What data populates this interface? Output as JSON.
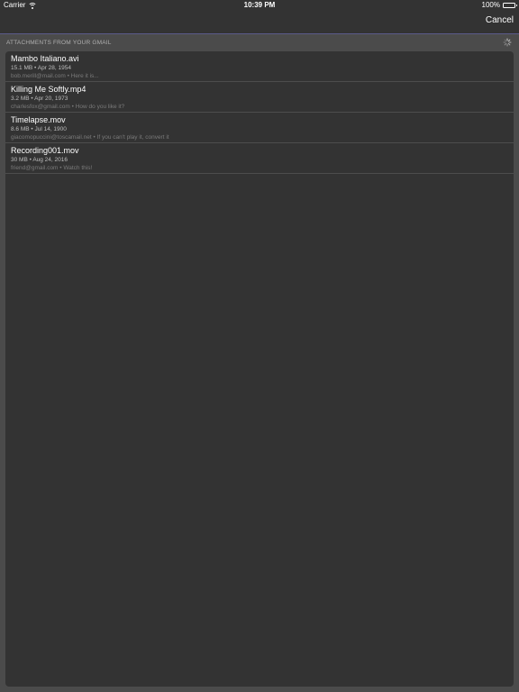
{
  "status_bar": {
    "carrier": "Carrier",
    "time": "10:39 PM",
    "battery": "100%",
    "battery_level": 1.0
  },
  "nav": {
    "cancel_label": "Cancel"
  },
  "section": {
    "header": "ATTACHMENTS FROM YOUR GMAIL"
  },
  "attachments": [
    {
      "name": "Mambo Italiano.avi",
      "meta": "15.1 MB • Apr 28, 1954",
      "sub": "bob.merill@mail.com • Here it is..."
    },
    {
      "name": "Killing Me Softly.mp4",
      "meta": "3.2 MB • Apr 20, 1973",
      "sub": "charlesfox@gmail.com • How do you like it?"
    },
    {
      "name": "Timelapse.mov",
      "meta": "8.6 MB • Jul 14, 1900",
      "sub": "giacomopuccini@toscamail.net • If you can't play it, convert it"
    },
    {
      "name": "Recording001.mov",
      "meta": "30 MB • Aug 24, 2016",
      "sub": "friend@gmail.com • Watch this!"
    }
  ],
  "colors": {
    "background": "#4b4b4b",
    "panel": "#333333",
    "nav_border": "#5a5a8a"
  },
  "icons": [
    "wifi-icon",
    "battery-icon",
    "loading-spinner-icon"
  ]
}
